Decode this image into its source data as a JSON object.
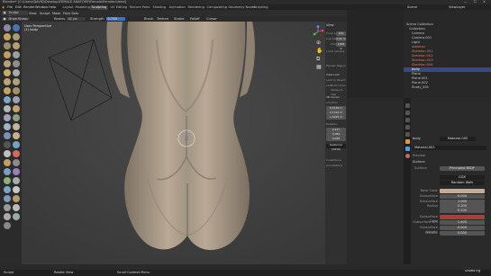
{
  "window": {
    "title": "Blender* [C:\\Users\\DAVID\\Desktop\\FEMALE ANATOMY\\Female\\Female.blend]"
  },
  "menu": [
    "File",
    "Edit",
    "Render",
    "Window",
    "Help"
  ],
  "workspace_tabs": [
    "Layout",
    "Modeling",
    "Sculpting",
    "UV Editing",
    "Texture Paint",
    "Shading",
    "Animation",
    "Rendering",
    "Compositing",
    "Geometry Nodes",
    "Scripting"
  ],
  "active_tab": "Sculpting",
  "header": {
    "mode": "Sculpt Mode",
    "menus": [
      "View",
      "Sculpt",
      "Mask",
      "Face Sets"
    ],
    "brush": "Draw Sharp",
    "radius_label": "Radius",
    "radius_value": "41 px",
    "strength_label": "Strength",
    "strength_value": "0.733",
    "right_menus": [
      "Brush",
      "Texture",
      "Stroke",
      "Falloff",
      "Cursor"
    ]
  },
  "viewport": {
    "overlay_line1": "User Perspective",
    "overlay_line2": "(1) body"
  },
  "npanel": {
    "view_header": "View",
    "focal_label": "Focal Length",
    "focal_value": "100 mm",
    "clip_start_label": "Clip Start",
    "clip_start_value": "0.01 m",
    "clip_end_label": "End",
    "clip_end_value": "1000 m",
    "local_camera": "Local Camera",
    "render_region": "Render Region",
    "view_lock": "View Lock",
    "lock_object": "Lock to Object",
    "lock_label": "Lock",
    "to_cursor": "To 3D Cursor",
    "camera_view": "Camera to View",
    "cursor_header": "3D Cursor",
    "location": "Location",
    "x": "0.0139 m",
    "y": "0.1312 m",
    "z": "1.5025 m",
    "rotation": "Rotation",
    "rx": "0.117",
    "ry": "0.084",
    "rz": "0.048",
    "rot_mode": "Quaternion (WXYZ)",
    "collections": "Collections",
    "annotations": "Annotations"
  },
  "outliner": {
    "search": "Scene",
    "layer": "ViewLayer",
    "items": [
      {
        "label": "Scene Collection"
      },
      {
        "label": "Collection"
      },
      {
        "label": "Camera"
      },
      {
        "label": "Camera.001"
      },
      {
        "label": "Light"
      },
      {
        "label": "skeleton"
      },
      {
        "label": "Skeleton.001"
      },
      {
        "label": "Skeleton.002"
      },
      {
        "label": "Skeleton.003"
      },
      {
        "label": "Skeleton.004"
      },
      {
        "label": "body"
      },
      {
        "label": "Plane"
      },
      {
        "label": "Plane.001"
      },
      {
        "label": "Plane.002"
      },
      {
        "label": "Study_001"
      }
    ],
    "selected_index": 10
  },
  "properties": {
    "object": "body",
    "material_name": "Material.005",
    "slot_name": "Material.001",
    "preview": "Preview",
    "surface_header": "Surface",
    "surface_label": "Surface",
    "surface_value": "Principled BSDF",
    "ggx": "GGX",
    "subsurf_method": "Random Walk",
    "rows": [
      {
        "label": "Base Color",
        "value": ""
      },
      {
        "label": "Subsurface",
        "value": "0.000"
      },
      {
        "label": "Subsurface Radius",
        "value": "1.000"
      },
      {
        "label": "",
        "value": "0.200"
      },
      {
        "label": "",
        "value": "0.100"
      },
      {
        "label": "Subsurface Color",
        "value": ""
      },
      {
        "label": "Subsurface IOR",
        "value": "1.400"
      },
      {
        "label": "Subsurface Anisotr.",
        "value": "0.000"
      },
      {
        "label": "Metallic",
        "value": "0.000"
      }
    ]
  },
  "status": {
    "left": "Sculpt",
    "middle": "Rotate View",
    "right": "Scroll Context Menu",
    "brand": "Udemy"
  },
  "colors": {
    "accent": "#4772b3",
    "skin": "#b9a995",
    "subsurface_color": "#b33a3a"
  }
}
